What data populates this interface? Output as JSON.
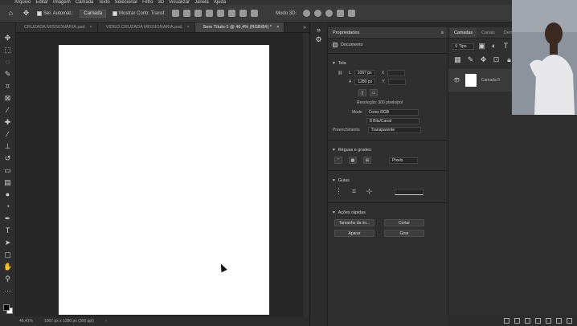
{
  "menu": [
    "Arquivo",
    "Editar",
    "Imagem",
    "Camada",
    "Texto",
    "Selecionar",
    "Filtro",
    "3D",
    "Visualizar",
    "Janela",
    "Ajuda"
  ],
  "options": {
    "auto_select_label": "Sel. Automát.:",
    "auto_select_value": "Camada",
    "transform_label": "Mostrar Contr. Transf.",
    "mode_label": "Modo 3D:"
  },
  "tabs": [
    {
      "label": "CRUZADA MISSIONÁRIA.psd",
      "active": false
    },
    {
      "label": "VIDEO CRUZADA MISSIONARIA.psd",
      "active": false
    },
    {
      "label": "Sem Título-1 @ 46,4% (RGB/8#) *",
      "active": true
    }
  ],
  "status": {
    "zoom": "46,41%",
    "doc_info": "1067 px x 1280 px (300 ppi)"
  },
  "properties": {
    "title": "Propriedades",
    "doc_label": "Documento",
    "tela_header": "Tela",
    "w_label": "L",
    "w_value": "1067 px",
    "h_label": "A",
    "h_value": "1280 px",
    "x_label": "X",
    "y_label": "Y",
    "resolution": "Resolução: 300 pixels/pol",
    "mode_label": "Modo",
    "mode_value": "Cores RGB",
    "depth_value": "8 Bits/Canal",
    "fill_label": "Preenchimento",
    "fill_value": "Transparente",
    "guides_header": "Réguas e grades",
    "units_value": "Pixels",
    "guides2_header": "Guias",
    "quick_header": "Ações rápidas",
    "btn_trim": "Tamanho da im...",
    "btn_crop": "Cortar",
    "btn_clear": "Aparar",
    "btn_rotate": "Girar"
  },
  "layers": {
    "tabs": [
      "Camadas",
      "Canais",
      "Demarc..."
    ],
    "filter_label": "Tipo",
    "layer_name": "Camada 0"
  }
}
